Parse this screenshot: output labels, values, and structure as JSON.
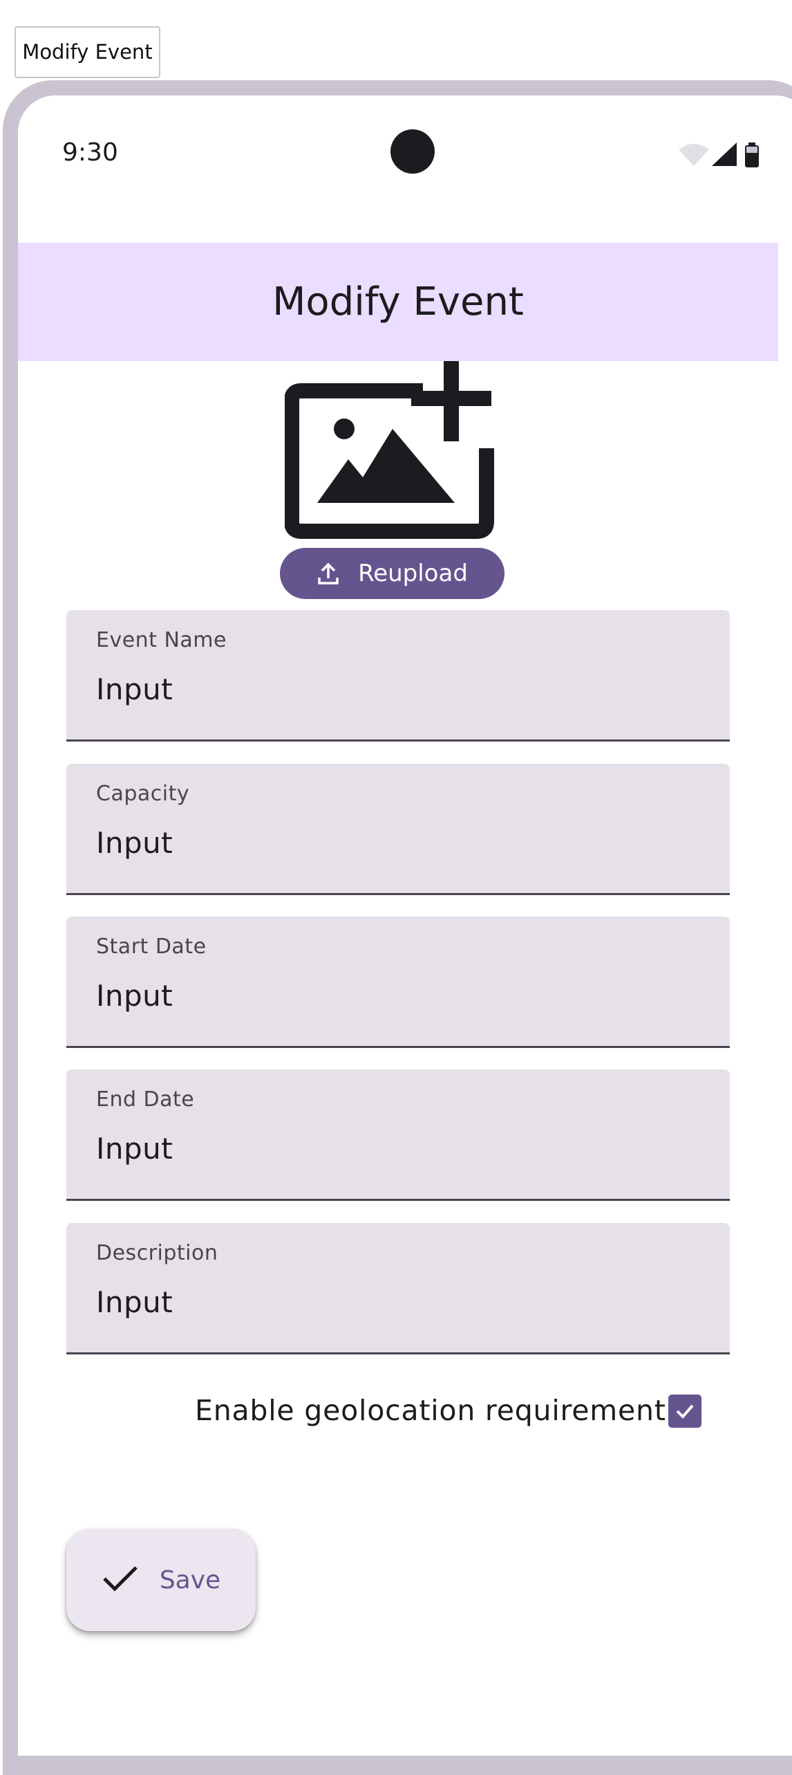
{
  "window": {
    "title_tab": "Modify Event"
  },
  "status_bar": {
    "time": "9:30"
  },
  "app_bar": {
    "title": "Modify Event"
  },
  "image_picker": {
    "icon": "add-photo-icon",
    "reupload_label": "Reupload",
    "reupload_icon": "upload-icon"
  },
  "form": {
    "fields": [
      {
        "label": "Event Name",
        "value": "Input"
      },
      {
        "label": "Capacity",
        "value": "Input"
      },
      {
        "label": "Start Date",
        "value": "Input"
      },
      {
        "label": "End Date",
        "value": "Input"
      },
      {
        "label": "Description",
        "value": "Input"
      }
    ],
    "geolocation": {
      "label": "Enable geolocation requirement",
      "checked": true
    }
  },
  "fab": {
    "save_label": "Save",
    "icon": "check-icon"
  },
  "colors": {
    "primary": "#65558f",
    "app_bar_bg": "#eaddff",
    "field_bg": "#e6e0e9",
    "fab_bg": "#ece6f0",
    "frame": "#cac4d0"
  }
}
